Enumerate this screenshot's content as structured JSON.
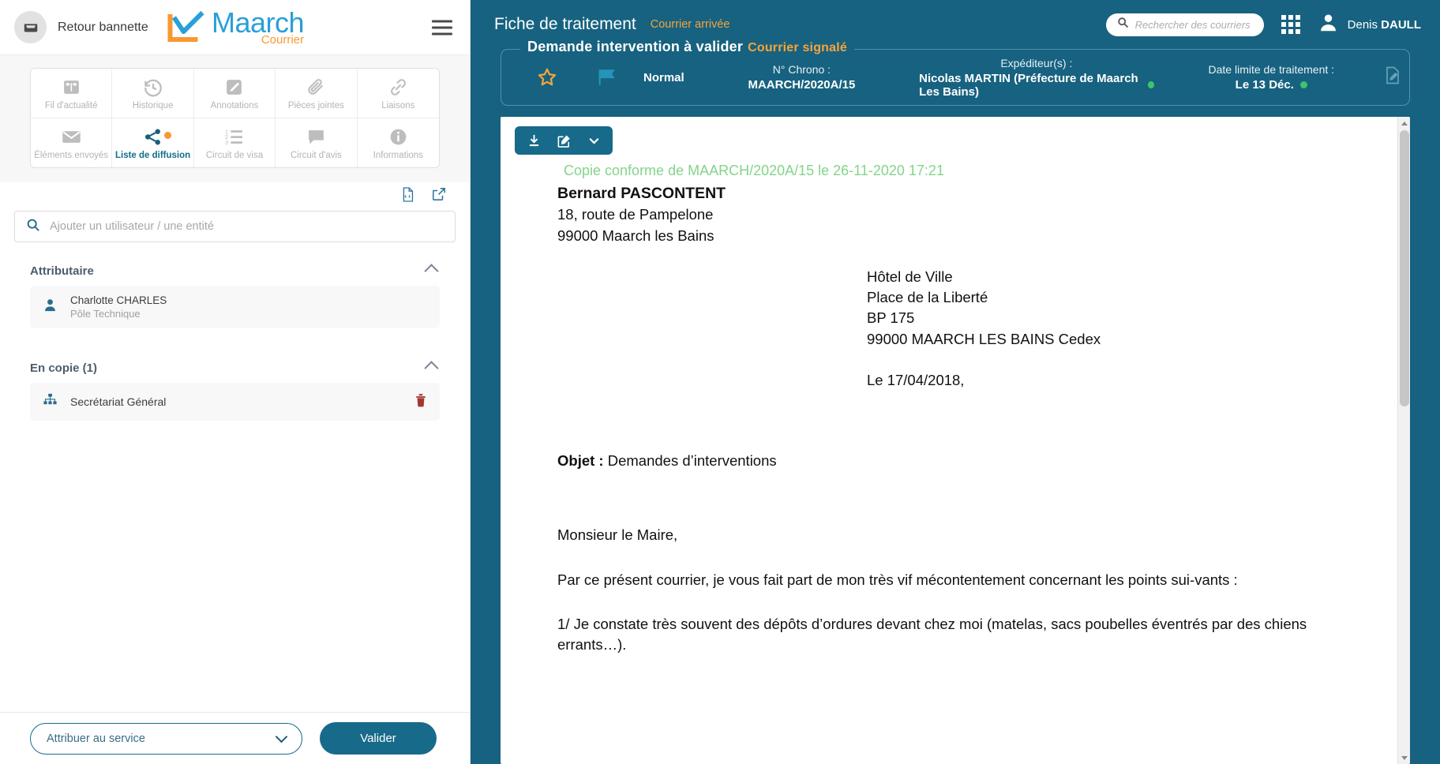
{
  "sidebar": {
    "back_label": "Retour bannette",
    "logo": {
      "name": "Maarch",
      "sub": "Courrier"
    },
    "tabs": [
      {
        "label": "Fil d'actualité",
        "icon": "columns-icon",
        "active": false
      },
      {
        "label": "Historique",
        "icon": "history-icon",
        "active": false
      },
      {
        "label": "Annotations",
        "icon": "pencil-square-icon",
        "active": false
      },
      {
        "label": "Pièces jointes",
        "icon": "paperclip-icon",
        "active": false
      },
      {
        "label": "Liaisons",
        "icon": "link-icon",
        "active": false
      },
      {
        "label": "Éléments envoyés",
        "icon": "envelope-icon",
        "active": false
      },
      {
        "label": "Liste de diffusion",
        "icon": "share-icon",
        "active": true,
        "badge": true
      },
      {
        "label": "Circuit de visa",
        "icon": "ordered-list-icon",
        "active": false
      },
      {
        "label": "Circuit d'avis",
        "icon": "speech-bubble-icon",
        "active": false
      },
      {
        "label": "Informations",
        "icon": "info-icon",
        "active": false
      }
    ],
    "list_actions": [
      {
        "icon": "document-template-icon"
      },
      {
        "icon": "external-link-icon"
      }
    ],
    "search": {
      "placeholder": "Ajouter un utilisateur / une entité",
      "value": ""
    },
    "sections": [
      {
        "title": "Attributaire",
        "collapse_icon": "chevron-up-icon",
        "items": [
          {
            "type": "user",
            "icon": "person-icon",
            "name": "Charlotte CHARLES",
            "sub": "Pôle Technique",
            "deletable": false
          }
        ]
      },
      {
        "title": "En copie (1)",
        "collapse_icon": "chevron-up-icon",
        "items": [
          {
            "type": "entity",
            "icon": "org-chart-icon",
            "name": "Secrétariat Général",
            "sub": "",
            "deletable": true,
            "delete_icon": "trash-icon"
          }
        ]
      }
    ],
    "footer": {
      "select_label": "Attribuer au service",
      "select_icon": "chevron-down-icon",
      "validate_label": "Valider"
    }
  },
  "header": {
    "title": "Fiche de traitement",
    "subtitle": "Courrier arrivée",
    "search": {
      "placeholder": "Rechercher des courriers",
      "value": "",
      "icon": "search-icon"
    },
    "apps_icon": "grid-apps-icon",
    "user": {
      "icon": "avatar-icon",
      "first_name": "Denis ",
      "last_name": "DAULL"
    }
  },
  "banner": {
    "legend": "Demande intervention à valider",
    "legend_flag": "Courrier signalé",
    "star_icon": "star-outline-icon",
    "flag_icon": "flag-icon",
    "priority": "Normal",
    "edit_icon": "edit-document-icon",
    "fields": [
      {
        "label": "N° Chrono :",
        "value": "MAARCH/2020A/15",
        "dot": false
      },
      {
        "label": "Expéditeur(s) :",
        "value": "Nicolas MARTIN (Préfecture de Maarch Les Bains)",
        "dot": true
      },
      {
        "label": "Date limite de traitement :",
        "value": "Le 13 Déc.",
        "dot": true
      }
    ]
  },
  "viewer": {
    "toolbar": [
      {
        "icon": "download-icon"
      },
      {
        "icon": "edit-square-icon"
      },
      {
        "icon": "chevron-down-icon"
      }
    ],
    "scrollbar": {
      "up_icon": "triangle-up-icon",
      "down_icon": "triangle-down-icon"
    },
    "document": {
      "copy_notice": "Copie conforme de MAARCH/2020A/15 le 26-11-2020 17:21",
      "sender_name": "Bernard PASCONTENT",
      "sender_lines": [
        "18, route de Pampelone",
        "99000 Maarch les Bains"
      ],
      "recipient_lines": [
        "Hôtel de Ville",
        "Place de la Liberté",
        "BP 175",
        "99000 MAARCH LES BAINS Cedex"
      ],
      "date_line": "Le 17/04/2018,",
      "subject_label": "Objet :",
      "subject_value": " Demandes d’interventions",
      "salutation": "Monsieur le Maire,",
      "paragraph_1": "Par ce présent courrier, je vous fait part de mon très vif mécontentement concernant les points sui-vants :",
      "paragraph_2": "1/ Je constate très souvent des dépôts d’ordures devant chez moi (matelas, sacs poubelles éventrés par des chiens errants…)."
    }
  },
  "colors": {
    "brand_blue": "#176280",
    "accent_orange": "#f7a43a",
    "logo_blue": "#2a9fd8",
    "green_status": "#3fc46a"
  }
}
